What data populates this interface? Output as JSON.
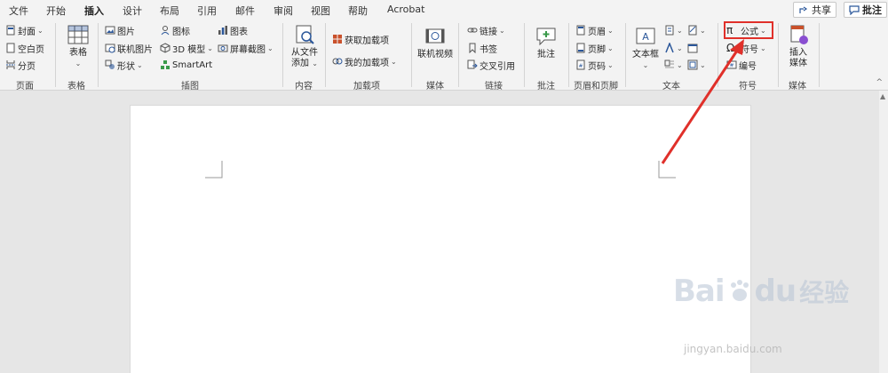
{
  "tabs": [
    {
      "label": "文件",
      "active": false
    },
    {
      "label": "开始",
      "active": false
    },
    {
      "label": "插入",
      "active": true
    },
    {
      "label": "设计",
      "active": false
    },
    {
      "label": "布局",
      "active": false
    },
    {
      "label": "引用",
      "active": false
    },
    {
      "label": "邮件",
      "active": false
    },
    {
      "label": "审阅",
      "active": false
    },
    {
      "label": "视图",
      "active": false
    },
    {
      "label": "帮助",
      "active": false
    },
    {
      "label": "Acrobat",
      "active": false
    }
  ],
  "top_buttons": {
    "share": "共享",
    "comment": "批注"
  },
  "ribbon": {
    "pages": {
      "label": "页面",
      "cover": "封面",
      "blank": "空白页",
      "break": "分页"
    },
    "tables": {
      "label": "表格",
      "table": "表格"
    },
    "illustrations": {
      "label": "插图",
      "picture": "图片",
      "online_picture": "联机图片",
      "shapes": "形状",
      "icons": "图标",
      "model3d": "3D 模型",
      "smartart": "SmartArt",
      "chart": "图表",
      "screenshot": "屏幕截图"
    },
    "content": {
      "label": "内容",
      "from_file": "从文件",
      "add": "添加"
    },
    "addins": {
      "label": "加载项",
      "get": "获取加载项",
      "mine": "我的加载项"
    },
    "media": {
      "label": "媒体",
      "online_video": "联机视频"
    },
    "links": {
      "label": "链接",
      "link": "链接",
      "bookmark": "书签",
      "cross_ref": "交叉引用"
    },
    "comments": {
      "label": "批注",
      "comment": "批注"
    },
    "header_footer": {
      "label": "页眉和页脚",
      "header": "页眉",
      "footer": "页脚",
      "page_number": "页码"
    },
    "text": {
      "label": "文本",
      "textbox": "文本框"
    },
    "symbols": {
      "label": "符号",
      "equation": "公式",
      "symbol": "符号",
      "number": "编号"
    },
    "media2": {
      "label": "媒体",
      "insert_media_1": "插入",
      "insert_media_2": "媒体"
    }
  },
  "watermark": {
    "brand": "Bai",
    "brand2": "du",
    "cn": "经验",
    "url": "jingyan.baidu.com"
  },
  "colors": {
    "accent": "#2b579a",
    "highlight": "#e0302a"
  }
}
